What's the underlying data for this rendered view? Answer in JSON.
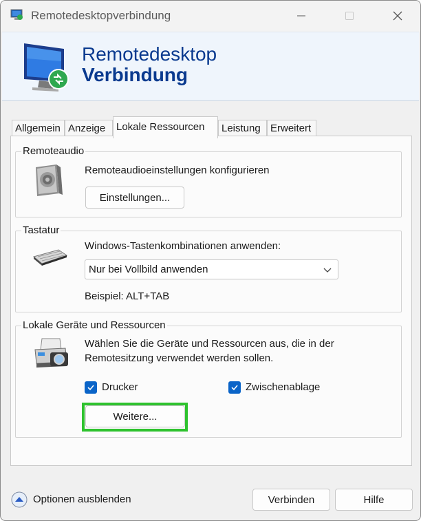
{
  "window": {
    "title": "Remotedesktopverbindung",
    "icon": "remote-desktop-app-icon"
  },
  "banner": {
    "line1": "Remotedesktop",
    "line2": "Verbindung"
  },
  "tabs": [
    {
      "label": "Allgemein",
      "active": false
    },
    {
      "label": "Anzeige",
      "active": false
    },
    {
      "label": "Lokale Ressourcen",
      "active": true
    },
    {
      "label": "Leistung",
      "active": false
    },
    {
      "label": "Erweitert",
      "active": false
    }
  ],
  "remoteaudio": {
    "group_label": "Remoteaudio",
    "description": "Remoteaudioeinstellungen konfigurieren",
    "button_label": "Einstellungen..."
  },
  "tastatur": {
    "group_label": "Tastatur",
    "description": "Windows-Tastenkombinationen anwenden:",
    "selected_option": "Nur bei Vollbild anwenden",
    "example": "Beispiel: ALT+TAB"
  },
  "devices": {
    "group_label": "Lokale Geräte und Ressourcen",
    "description_line1": "Wählen Sie die Geräte und Ressourcen aus, die in der",
    "description_line2": "Remotesitzung verwendet werden sollen.",
    "checkbox_printer": {
      "label": "Drucker",
      "checked": true
    },
    "checkbox_clipboard": {
      "label": "Zwischenablage",
      "checked": true
    },
    "more_button_label": "Weitere..."
  },
  "footer": {
    "options_label": "Optionen ausblenden",
    "connect_label": "Verbinden",
    "help_label": "Hilfe"
  },
  "colors": {
    "accent": "#0a64c8",
    "banner_title": "#0a3a8f",
    "highlight": "#2ec22e"
  }
}
